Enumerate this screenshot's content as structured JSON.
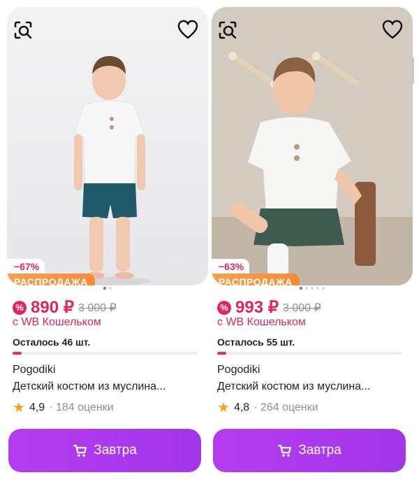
{
  "cards": [
    {
      "discount": "−67%",
      "sale_label": "РАСПРОДАЖА",
      "price": "890 ₽",
      "old_price": "3 000 ₽",
      "wallet_label": "с WB Кошельком",
      "remaining": "Осталось 46 шт.",
      "stock_fraction": 0.05,
      "brand": "Pogodiki",
      "title": "Детский костюм из муслина...",
      "rating": "4,9",
      "reviews": "· 184 оценки",
      "button_label": "Завтра",
      "dots_count": 2,
      "active_dot": 0
    },
    {
      "discount": "−63%",
      "sale_label": "РАСПРОДАЖА",
      "price": "993 ₽",
      "old_price": "3 000 ₽",
      "wallet_label": "с WB Кошельком",
      "remaining": "Осталось 55 шт.",
      "stock_fraction": 0.05,
      "brand": "Pogodiki",
      "title": "Детский костюм из муслина...",
      "rating": "4,8",
      "reviews": "· 264 оценки",
      "button_label": "Завтра",
      "dots_count": 5,
      "active_dot": 0
    }
  ],
  "icons": {
    "search_similar": "image-search-icon",
    "favorite": "heart-icon",
    "wallet": "wallet-discount-icon",
    "star": "star-icon",
    "cart": "cart-icon"
  },
  "colors": {
    "accent_purple": "#a336ea",
    "price_red": "#e0245e",
    "sale_orange": "#f58b3b",
    "star_orange": "#ff9f1c"
  }
}
